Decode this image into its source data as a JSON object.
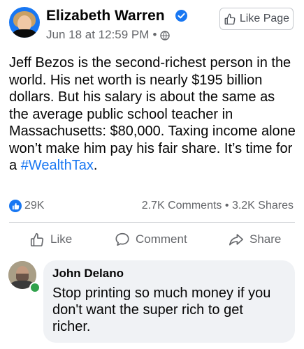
{
  "post": {
    "author": "Elizabeth Warren",
    "date": "Jun 18 at 12:59 PM",
    "separator": "•",
    "like_page_label": "Like Page",
    "text_main": "Jeff Bezos is the second-richest person in the world. His net worth is nearly $195 billion dollars. But his salary is about the same as the average public school teacher in Massachusetts: $80,000. Taxing income alone won’t make him pay his fair share. It’s time for a",
    "hashtag": "#WealthTax",
    "text_end": "."
  },
  "stats": {
    "reactions": "29K",
    "comments": "2.7K Comments",
    "dot": "•",
    "shares": "3.2K Shares"
  },
  "actions": {
    "like": "Like",
    "comment": "Comment",
    "share": "Share"
  },
  "comment": {
    "author": "John Delano",
    "text": "Stop printing so much money if you don't want the super rich to get richer."
  },
  "colors": {
    "accent": "#1877f2",
    "muted": "#65676b",
    "bubble": "#f0f2f5",
    "online": "#31a24c"
  },
  "icons": [
    "verified-badge-icon",
    "globe-icon",
    "thumbs-up-icon",
    "comment-icon",
    "share-icon"
  ]
}
